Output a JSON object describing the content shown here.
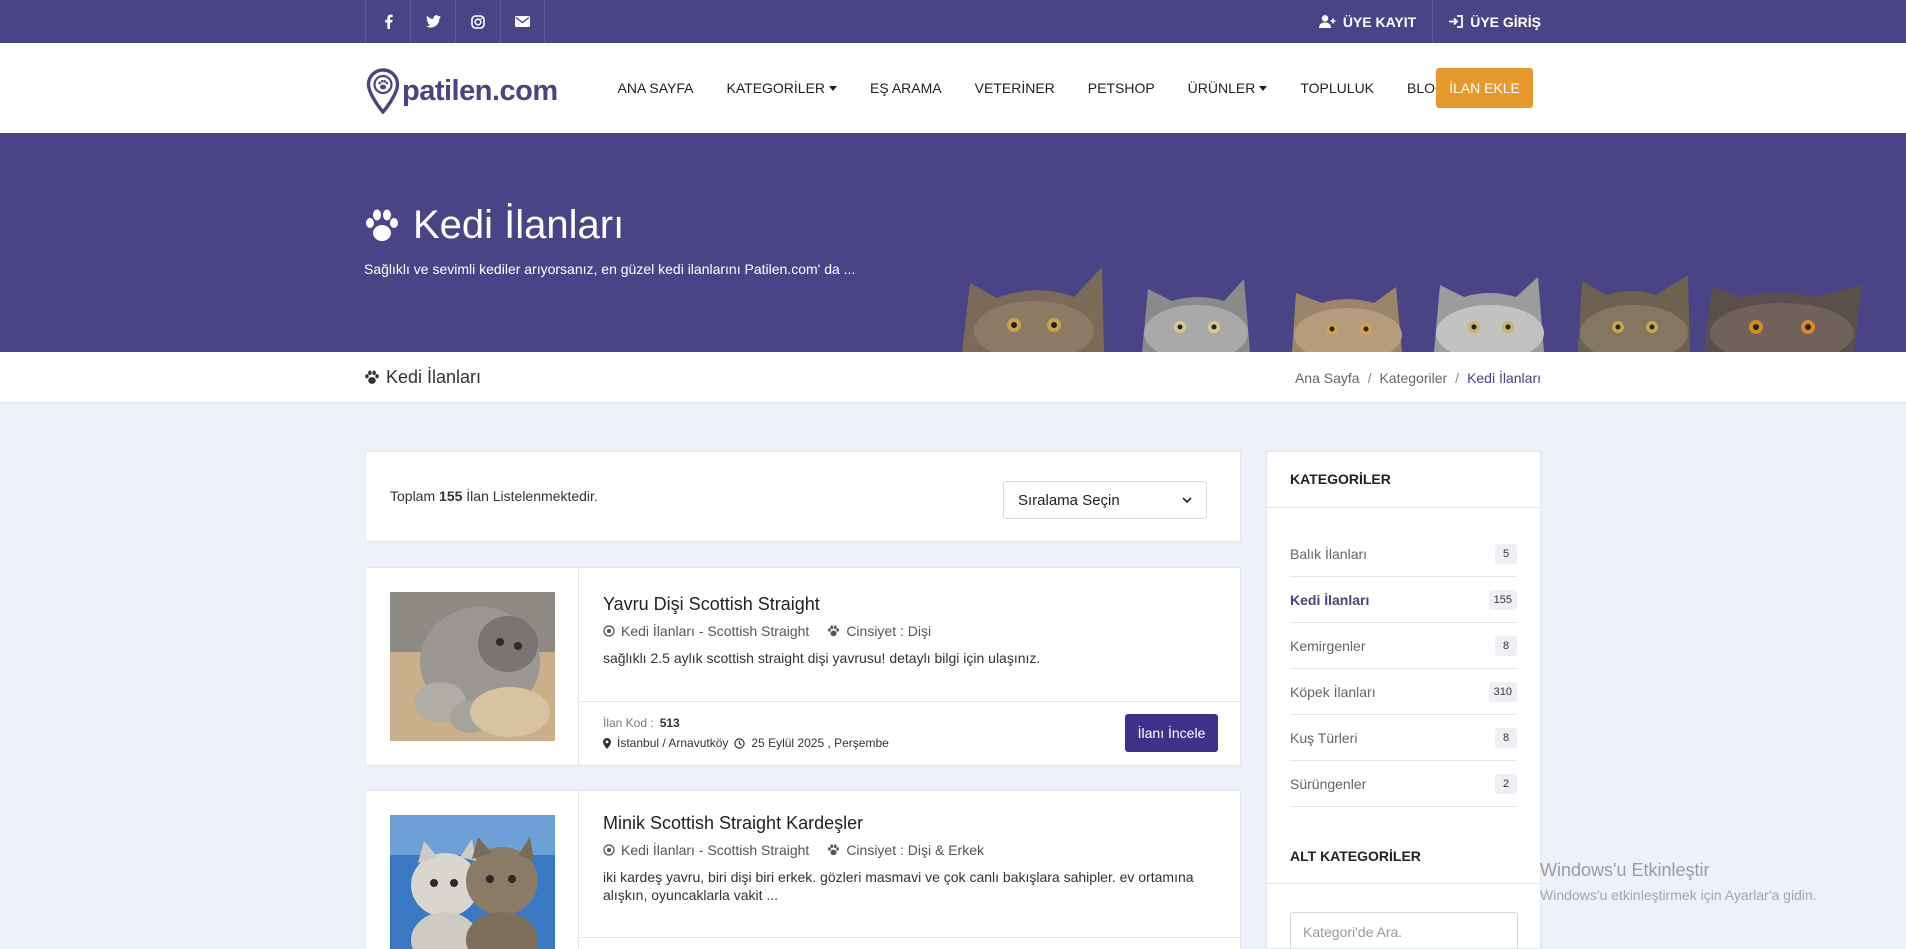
{
  "topbar": {
    "social": [
      {
        "icon": "facebook-icon"
      },
      {
        "icon": "twitter-icon"
      },
      {
        "icon": "instagram-icon"
      },
      {
        "icon": "envelope-icon"
      }
    ],
    "register_label": "ÜYE KAYIT",
    "login_label": "ÜYE GİRİŞ"
  },
  "nav": {
    "logo_text": "patilen.com",
    "items": [
      "ANA SAYFA",
      "KATEGORİLER",
      "EŞ ARAMA",
      "VETERİNER",
      "PETSHOP",
      "ÜRÜNLER",
      "TOPLULUK",
      "BLOG"
    ],
    "cta_label": "İLAN EKLE",
    "colors": {
      "brand": "#4a4385",
      "cta": "#e69a2e"
    }
  },
  "hero": {
    "title": "Kedi İlanları",
    "subtitle": "Sağlıklı ve sevimli kediler arıyorsanız, en güzel kedi ilanlarını Patilen.com' da ..."
  },
  "breadcrumb": {
    "page_title": "Kedi İlanları",
    "items": [
      "Ana Sayfa",
      "Kategoriler",
      "Kedi İlanları"
    ],
    "separator": "/"
  },
  "listing": {
    "total_prefix": "Toplam",
    "total_count": "155",
    "total_suffix": "İlan Listelenmektedir.",
    "sort_label": "Sıralama Seçin",
    "cards": [
      {
        "title": "Yavru Dişi Scottish Straight",
        "category": "Kedi İlanları - Scottish Straight",
        "gender": "Cinsiyet : Dişi",
        "desc": "sağlıklı 2.5 aylık scottish straight dişi yavrusu! detaylı bilgi için ulaşınız.",
        "code_label": "İlan Kod :",
        "code": "513",
        "location": "İstanbul / Arnavutköy",
        "date": "25 Eylül 2025 , Perşembe",
        "button": "İlanı İncele"
      },
      {
        "title": "Minik Scottish Straight Kardeşler",
        "category": "Kedi İlanları - Scottish Straight",
        "gender": "Cinsiyet : Dişi & Erkek",
        "desc": "iki kardeş yavru, biri dişi biri erkek. gözleri masmavi ve çok canlı bakışlara sahipler. ev ortamına alışkın, oyuncaklarla vakit ..."
      }
    ]
  },
  "sidebar": {
    "heading": "KATEGORİLER",
    "categories": [
      {
        "label": "Balık İlanları",
        "count": "5"
      },
      {
        "label": "Kedi İlanları",
        "count": "155"
      },
      {
        "label": "Kemirgenler",
        "count": "8"
      },
      {
        "label": "Köpek İlanları",
        "count": "310"
      },
      {
        "label": "Kuş Türleri",
        "count": "8"
      },
      {
        "label": "Sürüngenler",
        "count": "2"
      }
    ],
    "sub_heading": "ALT KATEGORİLER",
    "search_placeholder": "Kategori'de Ara."
  },
  "watermark": {
    "line1": "Windows'u Etkinleştir",
    "line2": "Windows'u etkinleştirmek için Ayarlar'a gidin."
  }
}
